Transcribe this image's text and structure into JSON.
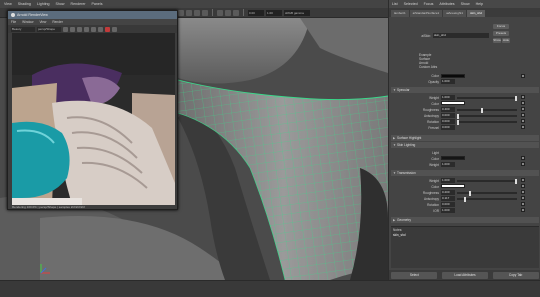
{
  "colors": {
    "wireframe": "#39d98a",
    "sss_teal": "#1a9ba6",
    "render_close": "#c23a3a",
    "title_bar": "#5b6c7d"
  },
  "viewport": {
    "menu": [
      "View",
      "Shading",
      "Lighting",
      "Show",
      "Renderer",
      "Panels"
    ],
    "toolbar_fields": [
      "0.00",
      "1.00"
    ],
    "toolbar_dropdown": "sRGB gamma"
  },
  "render_window": {
    "title": "Arnold RenderView",
    "menu": [
      "File",
      "Window",
      "View",
      "Render"
    ],
    "dropdown_camera": "Beauty",
    "dropdown_cam2": "persp/Shape",
    "status": "Rendering 100.0%  |  persp/Shape  |  samples 2/2/2/2/2/2"
  },
  "right_panel": {
    "menu": [
      "List",
      "Selected",
      "Focus",
      "Attributes",
      "Show",
      "Help"
    ],
    "tabs": [
      "lambert1",
      "aiStandardSurface1",
      "aiAreaLight1",
      "aiStandard",
      "aiSkin",
      "skin_shd"
    ],
    "header": {
      "node_label": "aiSkin:",
      "node_name": "skin_shd",
      "focus_btn": "Focus",
      "presets_btn": "Presets",
      "show_btn": "Show",
      "hide_btn": "Hide",
      "sample_labels": [
        "Example",
        "Surface",
        "Arnold",
        "Custom Attrs"
      ]
    },
    "sections": {
      "top": {
        "color_label": "Color",
        "opacity_label": "Opacity",
        "opacity_value": "1.000"
      },
      "specular": {
        "title": "Specular",
        "weight_label": "Weight",
        "weight_value": "1.000",
        "color_label": "Color",
        "roughness_label": "Roughness",
        "roughness_value": "0.400",
        "anisotropy_label": "Anisotropy",
        "anisotropy_value": "0.000",
        "rotation_label": "Rotation",
        "rotation_value": "0.000",
        "fresnel_label": "Fresnel",
        "fresnel_value": "0.000"
      },
      "surface_highlight": {
        "title": "Surface Highlight"
      },
      "sss": {
        "title": "Skin Lighting",
        "light_label": "Light",
        "color_label": "Color",
        "weight_label": "Weight",
        "weight_value": "1.000"
      },
      "transmission": {
        "title": "Transmission",
        "weight_label": "Weight",
        "weight_value": "1.000",
        "color_label": "Color",
        "roughness_label": "Roughness",
        "roughness_value": "0.200",
        "anisotropy_label": "Anisotropy",
        "anisotropy_value": "0.117",
        "rotation_label": "Rotation",
        "rotation_value": "0.000",
        "ior_label": "IOR",
        "ior_value": "1.000"
      },
      "geometry": {
        "title": "Geometry"
      }
    },
    "notes_label": "Notes:",
    "notes_text": "skin_shd",
    "bottom_buttons": [
      "Select",
      "Load Attributes",
      "Copy Tab"
    ]
  }
}
